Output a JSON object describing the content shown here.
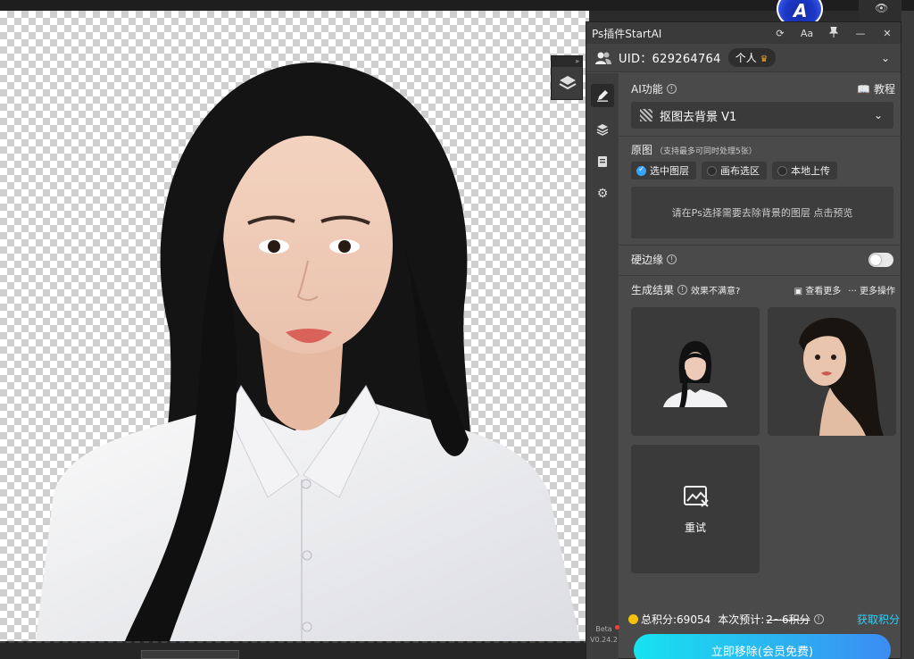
{
  "panel": {
    "title": "Ps插件StartAI",
    "title_buttons": [
      "⟳",
      "Aa",
      "📌",
      "—",
      "✕"
    ],
    "uid_label": "UID：629264764",
    "plan_label": "个人",
    "plan_icon": "crown-icon"
  },
  "ai": {
    "section_label": "AI功能",
    "tutorial_label": "教程",
    "selected_feature": "抠图去背景 V1"
  },
  "source": {
    "label": "原图",
    "hint": "（支持最多可同时处理5张）",
    "options": [
      "选中图层",
      "画布选区",
      "本地上传"
    ],
    "selected_index": 0,
    "dropzone_text": "请在Ps选择需要去除背景的图层 点击预览"
  },
  "edge": {
    "label": "硬边缘",
    "enabled": false
  },
  "results": {
    "label": "生成结果",
    "unsatisfied": "效果不满意?",
    "view_more": "查看更多",
    "more_actions": "更多操作",
    "retry_label": "重试"
  },
  "footer": {
    "total_points": "总积分:69054",
    "estimate_label": "本次预计:",
    "estimate_value": "2~6积分",
    "get_points": "获取积分",
    "cta_label": "立即移除(会员免费)",
    "beta": "Beta",
    "version": "V0.24.2"
  },
  "colors": {
    "accent": "#35a3ff",
    "cta_start": "#17e3ef",
    "cta_end": "#3b8cf2",
    "link": "#2fd0ff",
    "panel_bg": "#4a4a4a"
  }
}
